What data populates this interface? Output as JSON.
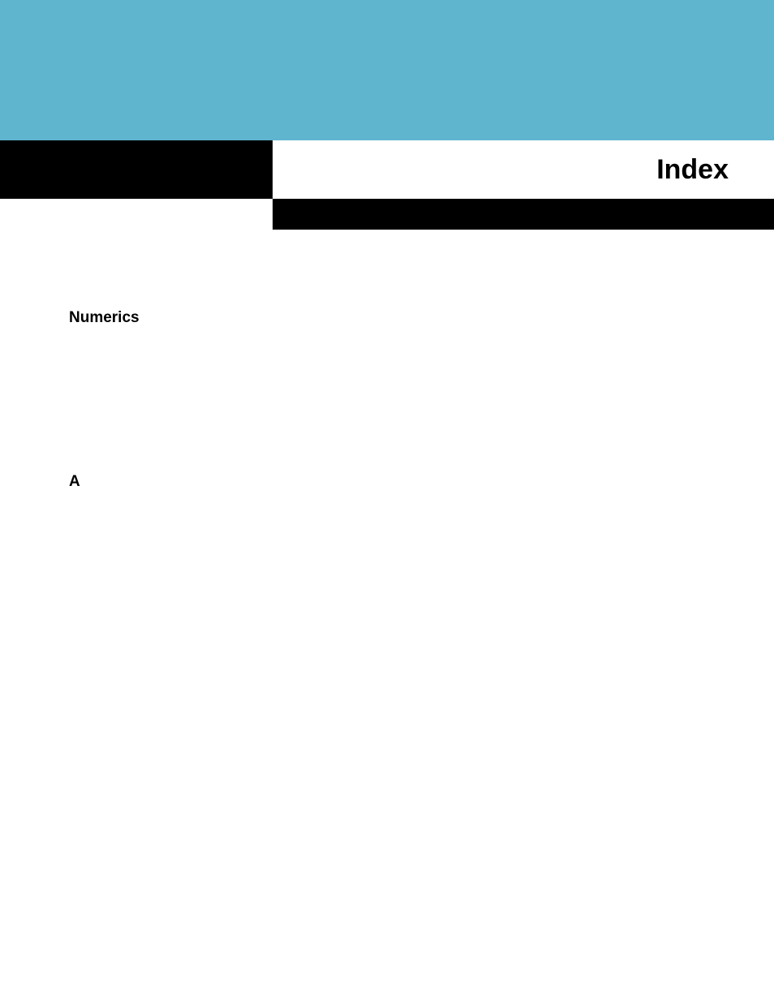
{
  "header": {
    "title": "Index"
  },
  "sections": [
    {
      "heading": "Numerics"
    },
    {
      "heading": "A"
    }
  ]
}
